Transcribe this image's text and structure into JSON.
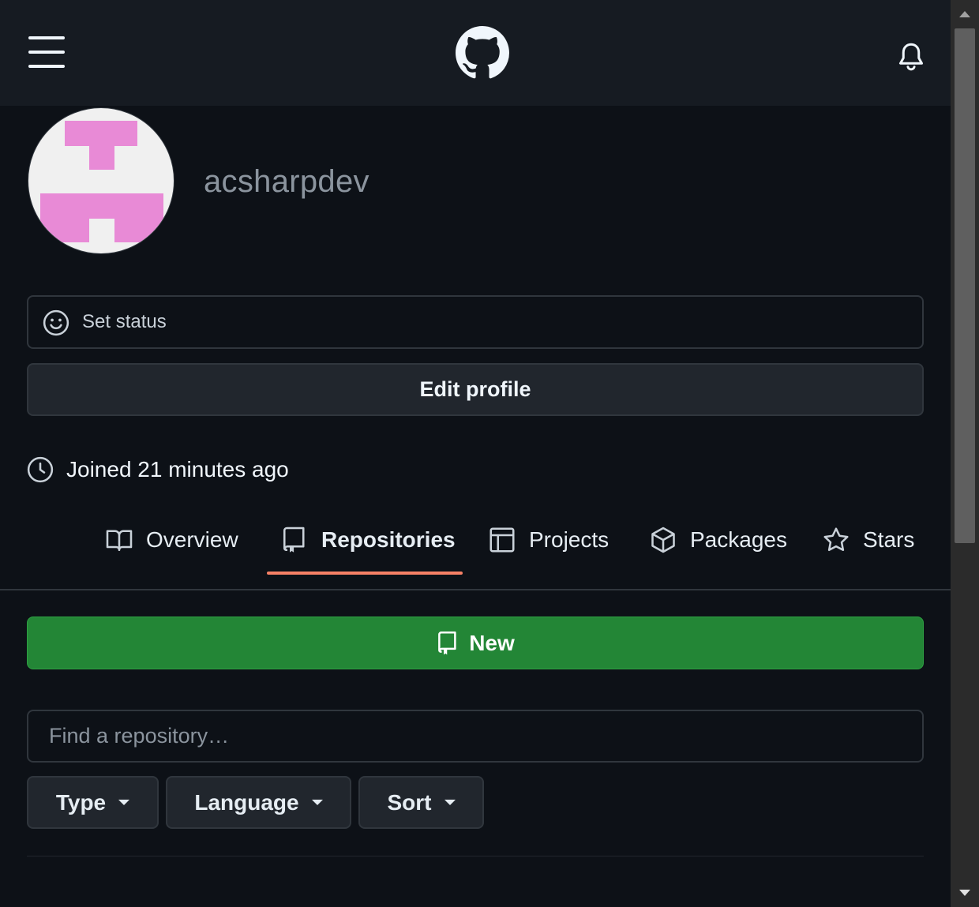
{
  "header": {
    "menu_icon": "hamburger-menu-icon",
    "logo_icon": "github-mark-icon",
    "notifications_icon": "bell-icon"
  },
  "profile": {
    "username": "acsharpdev",
    "avatar_icon": "identicon-avatar",
    "avatar_color": "#e88ad6",
    "set_status_label": "Set status",
    "edit_profile_label": "Edit profile",
    "joined_text": "Joined 21 minutes ago"
  },
  "tabs": [
    {
      "label": "Overview",
      "icon": "book-icon",
      "active": false
    },
    {
      "label": "Repositories",
      "icon": "repo-icon",
      "active": true
    },
    {
      "label": "Projects",
      "icon": "table-icon",
      "active": false
    },
    {
      "label": "Packages",
      "icon": "package-icon",
      "active": false
    },
    {
      "label": "Stars",
      "icon": "star-icon",
      "active": false
    }
  ],
  "repositories": {
    "new_button_label": "New",
    "search_placeholder": "Find a repository…",
    "filters": [
      {
        "label": "Type"
      },
      {
        "label": "Language"
      },
      {
        "label": "Sort"
      }
    ]
  },
  "colors": {
    "background": "#0d1117",
    "header": "#161b22",
    "active_tab_underline": "#f78166",
    "new_button": "#238636"
  }
}
